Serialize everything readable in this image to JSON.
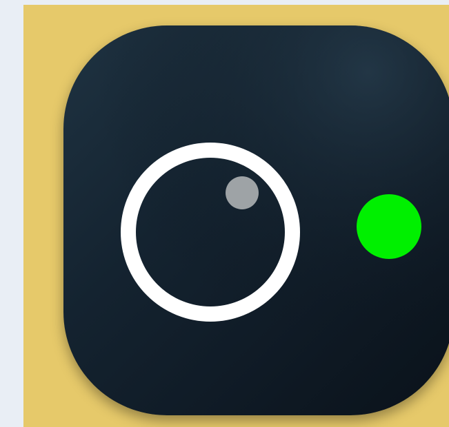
{
  "colors": {
    "page_background": "#e9eef5",
    "tile_background": "#e6c96a",
    "icon_background_light": "#1f3342",
    "icon_background_dark": "#0a121a",
    "lens_ring": "#ffffff",
    "lens_glint": "#9ea3a6",
    "status_light": "#00f000"
  },
  "icons": {
    "app_icon": "camera-app-icon",
    "lens": "camera-lens-icon",
    "glint": "lens-highlight",
    "status": "recording-indicator-dot"
  }
}
